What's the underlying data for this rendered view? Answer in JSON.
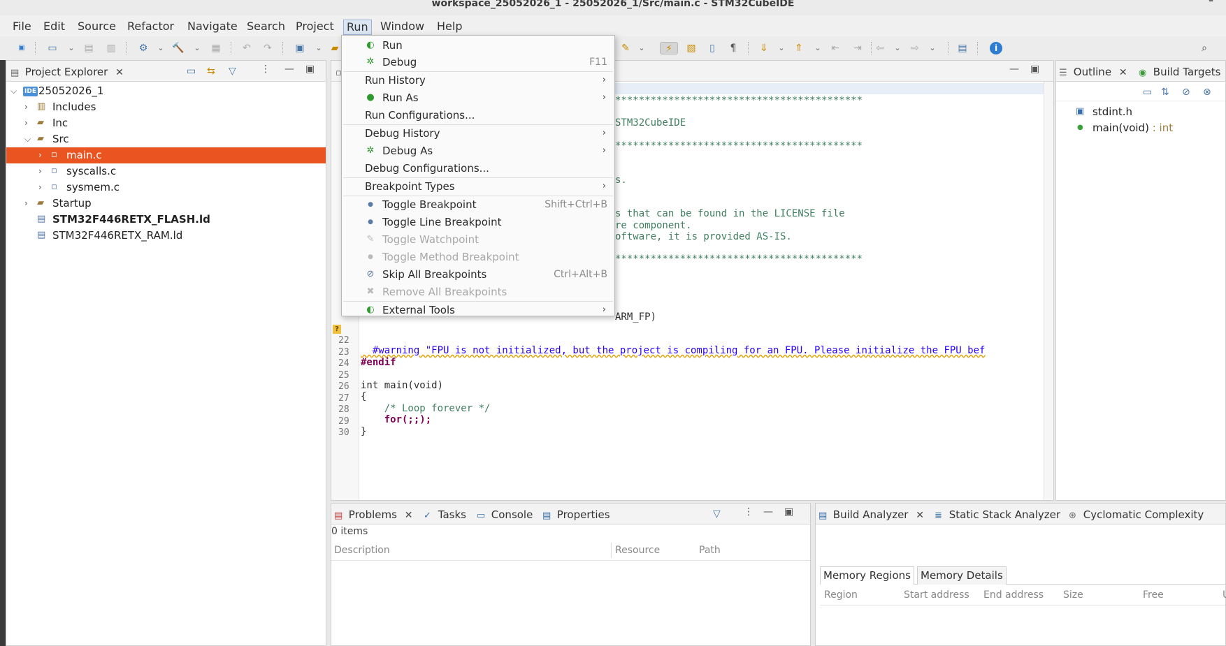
{
  "window": {
    "title": "workspace_25052026_1 - 25052026_1/Src/main.c - STM32CubeIDE"
  },
  "menubar": [
    "File",
    "Edit",
    "Source",
    "Refactor",
    "Navigate",
    "Search",
    "Project",
    "Run",
    "Window",
    "Help"
  ],
  "project_explorer": {
    "title": "Project Explorer",
    "items": [
      {
        "label": "25052026_1",
        "icon": "ide-project-icon",
        "icon_text": "IDE"
      },
      {
        "label": "Includes",
        "icon": "includes-icon"
      },
      {
        "label": "Inc",
        "icon": "folder-icon"
      },
      {
        "label": "Src",
        "icon": "folder-icon"
      },
      {
        "label": "main.c",
        "icon": "c-file-icon"
      },
      {
        "label": "syscalls.c",
        "icon": "c-file-icon"
      },
      {
        "label": "sysmem.c",
        "icon": "c-file-icon"
      },
      {
        "label": "Startup",
        "icon": "folder-icon"
      },
      {
        "label": "STM32F446RETX_FLASH.ld",
        "icon": "linker-file-icon"
      },
      {
        "label": "STM32F446RETX_RAM.ld",
        "icon": "linker-file-icon"
      }
    ]
  },
  "outline": {
    "tabs": [
      "Outline",
      "Build Targets"
    ],
    "items": [
      {
        "label": "stdint.h",
        "type": ""
      },
      {
        "label": "main(void)",
        "type": " : int"
      }
    ]
  },
  "editor": {
    "visible_fragments": [
      "******************************************",
      "STM32CubeIDE",
      "******************************************",
      "s.",
      "s that can be found in the LICENSE file",
      "re component.",
      "oftware, it is provided AS-IS.",
      "******************************************",
      "ARM_FP)"
    ],
    "lines": [
      {
        "n": "22",
        "text": "  #warning \"FPU is not initialized, but the project is compiling for an FPU. Please initialize the FPU bef"
      },
      {
        "n": "23",
        "text": "#endif"
      },
      {
        "n": "24",
        "text": ""
      },
      {
        "n": "25",
        "text": "int main(void)"
      },
      {
        "n": "26",
        "text": "{"
      },
      {
        "n": "27",
        "text": "    /* Loop forever */"
      },
      {
        "n": "28",
        "text": "    for(;;);"
      },
      {
        "n": "29",
        "text": "}"
      },
      {
        "n": "30",
        "text": ""
      }
    ],
    "warning_marker": "?"
  },
  "run_menu": {
    "items": [
      {
        "label": "Run",
        "icon": "run-icon",
        "accel": "",
        "submenu": false,
        "disabled": false
      },
      {
        "label": "Debug",
        "icon": "debug-icon",
        "accel": "F11",
        "submenu": false,
        "disabled": false
      },
      {
        "label": "Run History",
        "icon": "",
        "accel": "",
        "submenu": true,
        "disabled": false
      },
      {
        "label": "Run As",
        "icon": "run-as-icon",
        "accel": "",
        "submenu": true,
        "disabled": false
      },
      {
        "label": "Run Configurations...",
        "icon": "",
        "accel": "",
        "submenu": false,
        "disabled": false
      },
      {
        "label": "Debug History",
        "icon": "",
        "accel": "",
        "submenu": true,
        "disabled": false
      },
      {
        "label": "Debug As",
        "icon": "debug-as-icon",
        "accel": "",
        "submenu": true,
        "disabled": false
      },
      {
        "label": "Debug Configurations...",
        "icon": "",
        "accel": "",
        "submenu": false,
        "disabled": false
      },
      {
        "label": "Breakpoint Types",
        "icon": "",
        "accel": "",
        "submenu": true,
        "disabled": false
      },
      {
        "label": "Toggle Breakpoint",
        "icon": "breakpoint-icon",
        "accel": "Shift+Ctrl+B",
        "submenu": false,
        "disabled": false
      },
      {
        "label": "Toggle Line Breakpoint",
        "icon": "line-breakpoint-icon",
        "accel": "",
        "submenu": false,
        "disabled": false
      },
      {
        "label": "Toggle Watchpoint",
        "icon": "watchpoint-icon",
        "accel": "",
        "submenu": false,
        "disabled": true
      },
      {
        "label": "Toggle Method Breakpoint",
        "icon": "method-breakpoint-icon",
        "accel": "",
        "submenu": false,
        "disabled": true
      },
      {
        "label": "Skip All Breakpoints",
        "icon": "skip-breakpoints-icon",
        "accel": "Ctrl+Alt+B",
        "submenu": false,
        "disabled": false
      },
      {
        "label": "Remove All Breakpoints",
        "icon": "remove-breakpoints-icon",
        "accel": "",
        "submenu": false,
        "disabled": true
      },
      {
        "label": "External Tools",
        "icon": "external-tools-icon",
        "accel": "",
        "submenu": true,
        "disabled": false
      }
    ]
  },
  "problems": {
    "tabs": [
      "Problems",
      "Tasks",
      "Console",
      "Properties"
    ],
    "count": "0 items",
    "columns": [
      "Description",
      "Resource",
      "Path"
    ]
  },
  "build_analyzer": {
    "tabs": [
      "Build Analyzer",
      "Static Stack Analyzer",
      "Cyclomatic Complexity"
    ],
    "subtabs": [
      "Memory Regions",
      "Memory Details"
    ],
    "columns": [
      "Region",
      "Start address",
      "End address",
      "Size",
      "Free",
      "U"
    ]
  },
  "colors": {
    "selection": "#e95420",
    "accent": "#4a76a8"
  }
}
